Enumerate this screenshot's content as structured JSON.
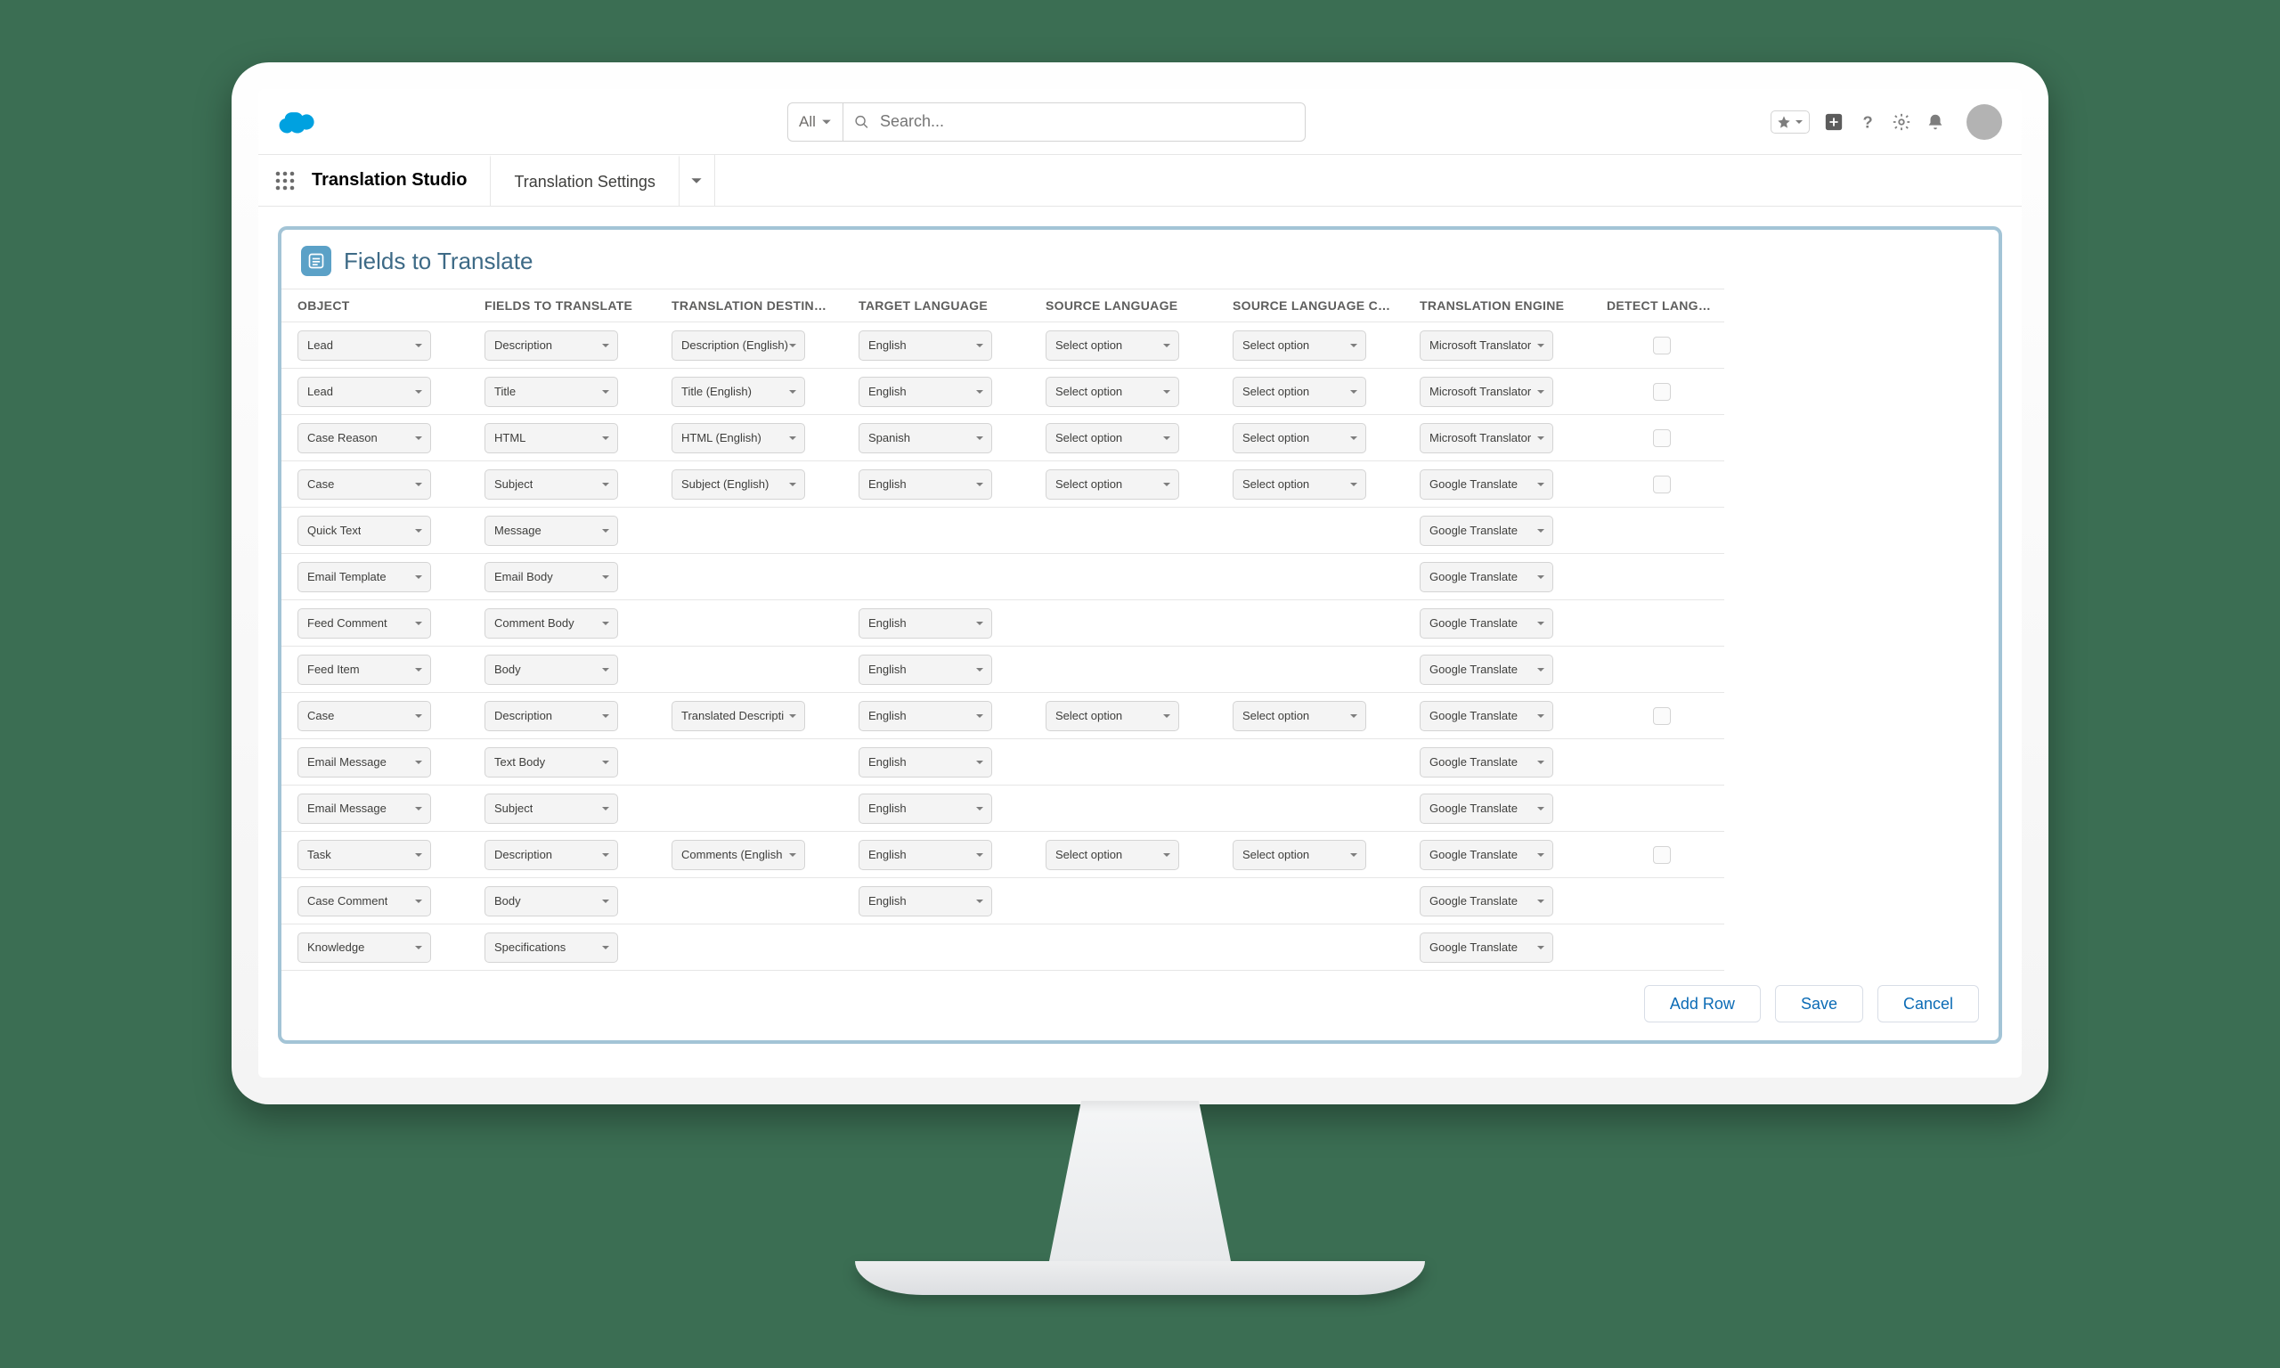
{
  "header": {
    "search_all": "All",
    "search_placeholder": "Search..."
  },
  "nav": {
    "app": "Translation Studio",
    "tab": "Translation Settings"
  },
  "panel": {
    "title": "Fields to Translate",
    "columns": [
      "OBJECT",
      "FIELDS TO TRANSLATE",
      "TRANSLATION DESTIN…",
      "TARGET LANGUAGE",
      "SOURCE LANGUAGE",
      "SOURCE LANGUAGE C…",
      "TRANSLATION ENGINE",
      "DETECT LANGUAGE"
    ],
    "buttons": {
      "add": "Add Row",
      "save": "Save",
      "cancel": "Cancel"
    },
    "rows": [
      {
        "object": "Lead",
        "field": "Description",
        "dest": "Description (English)",
        "target": "English",
        "source": "Select option",
        "sourcec": "Select option",
        "engine": "Microsoft Translator",
        "detect": true
      },
      {
        "object": "Lead",
        "field": "Title",
        "dest": "Title (English)",
        "target": "English",
        "source": "Select option",
        "sourcec": "Select option",
        "engine": "Microsoft Translator",
        "detect": true
      },
      {
        "object": "Case Reason",
        "field": "HTML",
        "dest": "HTML (English)",
        "target": "Spanish",
        "source": "Select option",
        "sourcec": "Select option",
        "engine": "Microsoft Translator",
        "detect": true
      },
      {
        "object": "Case",
        "field": "Subject",
        "dest": "Subject (English)",
        "target": "English",
        "source": "Select option",
        "sourcec": "Select option",
        "engine": "Google Translate",
        "detect": true
      },
      {
        "object": "Quick Text",
        "field": "Message",
        "dest": "",
        "target": "",
        "source": "",
        "sourcec": "",
        "engine": "Google Translate",
        "detect": false
      },
      {
        "object": "Email Template",
        "field": "Email Body",
        "dest": "",
        "target": "",
        "source": "",
        "sourcec": "",
        "engine": "Google Translate",
        "detect": false
      },
      {
        "object": "Feed Comment",
        "field": "Comment Body",
        "dest": "",
        "target": "English",
        "source": "",
        "sourcec": "",
        "engine": "Google Translate",
        "detect": false
      },
      {
        "object": "Feed Item",
        "field": "Body",
        "dest": "",
        "target": "English",
        "source": "",
        "sourcec": "",
        "engine": "Google Translate",
        "detect": false
      },
      {
        "object": "Case",
        "field": "Description",
        "dest": "Translated Descripti",
        "target": "English",
        "source": "Select option",
        "sourcec": "Select option",
        "engine": "Google Translate",
        "detect": true
      },
      {
        "object": "Email Message",
        "field": "Text Body",
        "dest": "",
        "target": "English",
        "source": "",
        "sourcec": "",
        "engine": "Google Translate",
        "detect": false
      },
      {
        "object": "Email Message",
        "field": "Subject",
        "dest": "",
        "target": "English",
        "source": "",
        "sourcec": "",
        "engine": "Google Translate",
        "detect": false
      },
      {
        "object": "Task",
        "field": "Description",
        "dest": "Comments (English",
        "target": "English",
        "source": "Select option",
        "sourcec": "Select option",
        "engine": "Google Translate",
        "detect": true
      },
      {
        "object": "Case Comment",
        "field": "Body",
        "dest": "",
        "target": "English",
        "source": "",
        "sourcec": "",
        "engine": "Google Translate",
        "detect": false
      },
      {
        "object": "Knowledge",
        "field": "Specifications",
        "dest": "",
        "target": "",
        "source": "",
        "sourcec": "",
        "engine": "Google Translate",
        "detect": false
      }
    ]
  }
}
